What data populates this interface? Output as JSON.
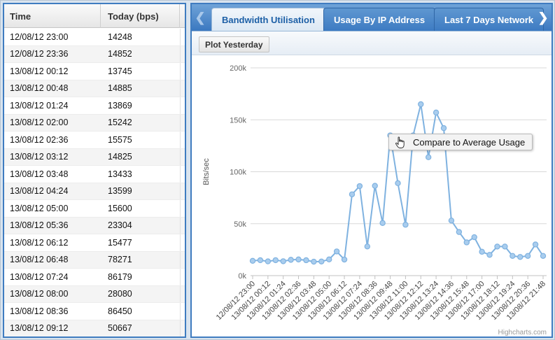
{
  "grid": {
    "columns": [
      "Time",
      "Today (bps)"
    ],
    "rows": [
      [
        "12/08/12 23:00",
        "14248"
      ],
      [
        "12/08/12 23:36",
        "14852"
      ],
      [
        "13/08/12 00:12",
        "13745"
      ],
      [
        "13/08/12 00:48",
        "14885"
      ],
      [
        "13/08/12 01:24",
        "13869"
      ],
      [
        "13/08/12 02:00",
        "15242"
      ],
      [
        "13/08/12 02:36",
        "15575"
      ],
      [
        "13/08/12 03:12",
        "14825"
      ],
      [
        "13/08/12 03:48",
        "13433"
      ],
      [
        "13/08/12 04:24",
        "13599"
      ],
      [
        "13/08/12 05:00",
        "15600"
      ],
      [
        "13/08/12 05:36",
        "23304"
      ],
      [
        "13/08/12 06:12",
        "15477"
      ],
      [
        "13/08/12 06:48",
        "78271"
      ],
      [
        "13/08/12 07:24",
        "86179"
      ],
      [
        "13/08/12 08:00",
        "28080"
      ],
      [
        "13/08/12 08:36",
        "86450"
      ],
      [
        "13/08/12 09:12",
        "50667"
      ]
    ]
  },
  "tabs": {
    "scroll_left": "❮",
    "scroll_right": "❯",
    "items": [
      "Bandwidth Utilisation",
      "Usage By IP Address",
      "Last 7 Days Network"
    ],
    "active_index": 0
  },
  "toolbar": {
    "plot_yesterday": "Plot Yesterday"
  },
  "tooltip": {
    "text": "Compare to Average Usage",
    "icon": "hand-pointer-icon"
  },
  "credits": "Highcharts.com",
  "colors": {
    "series": "#7fb2e0",
    "marker": "#a9cdee",
    "tab_bar": "#3b78c0",
    "panel_border": "#3f7cc0"
  },
  "chart_data": {
    "type": "line",
    "ylabel": "Bits/sec",
    "ylim": [
      0,
      200000
    ],
    "yticks": [
      "0k",
      "50k",
      "100k",
      "150k",
      "200k"
    ],
    "grid": true,
    "x": [
      "12/08/12 23:00",
      "12/08/12 23:36",
      "13/08/12 00:12",
      "13/08/12 00:48",
      "13/08/12 01:24",
      "13/08/12 02:00",
      "13/08/12 02:36",
      "13/08/12 03:12",
      "13/08/12 03:48",
      "13/08/12 04:24",
      "13/08/12 05:00",
      "13/08/12 05:36",
      "13/08/12 06:12",
      "13/08/12 06:48",
      "13/08/12 07:24",
      "13/08/12 08:00",
      "13/08/12 08:36",
      "13/08/12 09:12",
      "13/08/12 09:48",
      "13/08/12 10:24",
      "13/08/12 11:00",
      "13/08/12 11:36",
      "13/08/12 12:12",
      "13/08/12 12:48",
      "13/08/12 13:24",
      "13/08/12 14:00",
      "13/08/12 14:36",
      "13/08/12 15:12",
      "13/08/12 15:48",
      "13/08/12 16:24",
      "13/08/12 17:00",
      "13/08/12 17:36",
      "13/08/12 18:12",
      "13/08/12 18:48",
      "13/08/12 19:24",
      "13/08/12 20:00",
      "13/08/12 20:36",
      "13/08/12 21:12",
      "13/08/12 21:48",
      "13/08/12 22:24"
    ],
    "xtick_labels": [
      "12/08/12 23:00",
      "13/08/12 00:12",
      "13/08/12 01:24",
      "13/08/12 02:36",
      "13/08/12 03:48",
      "13/08/12 05:00",
      "13/08/12 06:12",
      "13/08/12 07:24",
      "13/08/12 08:36",
      "13/08/12 09:48",
      "13/08/12 11:00",
      "13/08/12 12:12",
      "13/08/12 13:24",
      "13/08/12 14:36",
      "13/08/12 15:48",
      "13/08/12 17:00",
      "13/08/12 18:12",
      "13/08/12 19:24",
      "13/08/12 20:36",
      "13/08/12 21:48"
    ],
    "values": [
      14248,
      14852,
      13745,
      14885,
      13869,
      15242,
      15575,
      14825,
      13433,
      13599,
      15600,
      23304,
      15477,
      78271,
      86179,
      28080,
      86450,
      50667,
      135000,
      89000,
      49000,
      135000,
      165000,
      114000,
      157000,
      142000,
      53000,
      42000,
      32000,
      37000,
      23000,
      20000,
      28000,
      28000,
      19000,
      18000,
      19000,
      30000,
      19000
    ]
  }
}
